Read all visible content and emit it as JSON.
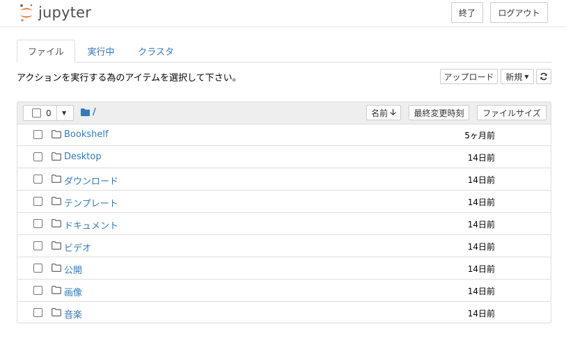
{
  "header": {
    "logo_text": "jupyter",
    "quit_label": "終了",
    "logout_label": "ログアウト"
  },
  "tabs": [
    {
      "label": "ファイル",
      "active": true
    },
    {
      "label": "実行中",
      "active": false
    },
    {
      "label": "クラスタ",
      "active": false
    }
  ],
  "toolbar": {
    "instruction": "アクションを実行する為のアイテムを選択して下さい。",
    "upload_label": "アップロード",
    "new_label": "新規"
  },
  "list_header": {
    "selected_count": "0",
    "path": "/",
    "sort_name_label": "名前",
    "sort_modified_label": "最終変更時刻",
    "sort_size_label": "ファイルサイズ"
  },
  "items": [
    {
      "name": "Bookshelf",
      "modified": "5ヶ月前"
    },
    {
      "name": "Desktop",
      "modified": "14日前"
    },
    {
      "name": "ダウンロード",
      "modified": "14日前"
    },
    {
      "name": "テンプレート",
      "modified": "14日前"
    },
    {
      "name": "ドキュメント",
      "modified": "14日前"
    },
    {
      "name": "ビデオ",
      "modified": "14日前"
    },
    {
      "name": "公開",
      "modified": "14日前"
    },
    {
      "name": "画像",
      "modified": "14日前"
    },
    {
      "name": "音楽",
      "modified": "14日前"
    }
  ],
  "icons": {
    "logo": "jupyter-logo-icon",
    "folder": "folder-outline-icon",
    "path_folder": "folder-solid-icon",
    "refresh": "refresh-icon",
    "caret": "caret-down-icon",
    "sort_arrow": "arrow-down-icon"
  },
  "colors": {
    "link": "#337ab7",
    "logo_orange": "#f37726",
    "header_bg": "#eeeeee"
  }
}
